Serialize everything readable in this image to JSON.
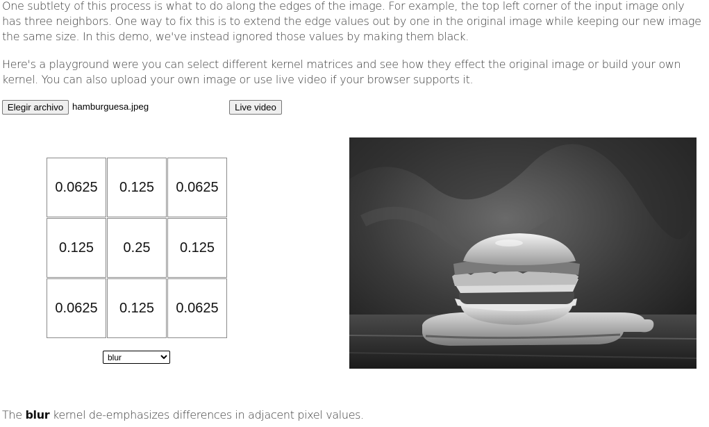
{
  "intro": {
    "paragraph_edges": "One subtlety of this process is what to do along the edges of the image. For example, the top left corner of the input image only has three neighbors. One way to fix this is to extend the edge values out by one in the original image while keeping our new image the same size. In this demo, we've instead ignored those values by making them black.",
    "paragraph_playground": "Here's a playground were you can select different kernel matrices and see how they effect the original image or build your own kernel. You can also upload your own image or use live video if your browser supports it."
  },
  "controls": {
    "file_button_label": "Elegir archivo",
    "file_name": "hamburguesa.jpeg",
    "live_video_label": "Live video"
  },
  "kernel": {
    "rows": [
      [
        "0.0625",
        "0.125",
        "0.0625"
      ],
      [
        "0.125",
        "0.25",
        "0.125"
      ],
      [
        "0.0625",
        "0.125",
        "0.0625"
      ]
    ],
    "selected": "blur",
    "options": [
      "blur"
    ]
  },
  "image": {
    "description_subject": "burger"
  },
  "explanation": {
    "prefix": "The ",
    "kernel_name": "blur",
    "suffix": " kernel de-emphasizes differences in adjacent pixel values."
  }
}
